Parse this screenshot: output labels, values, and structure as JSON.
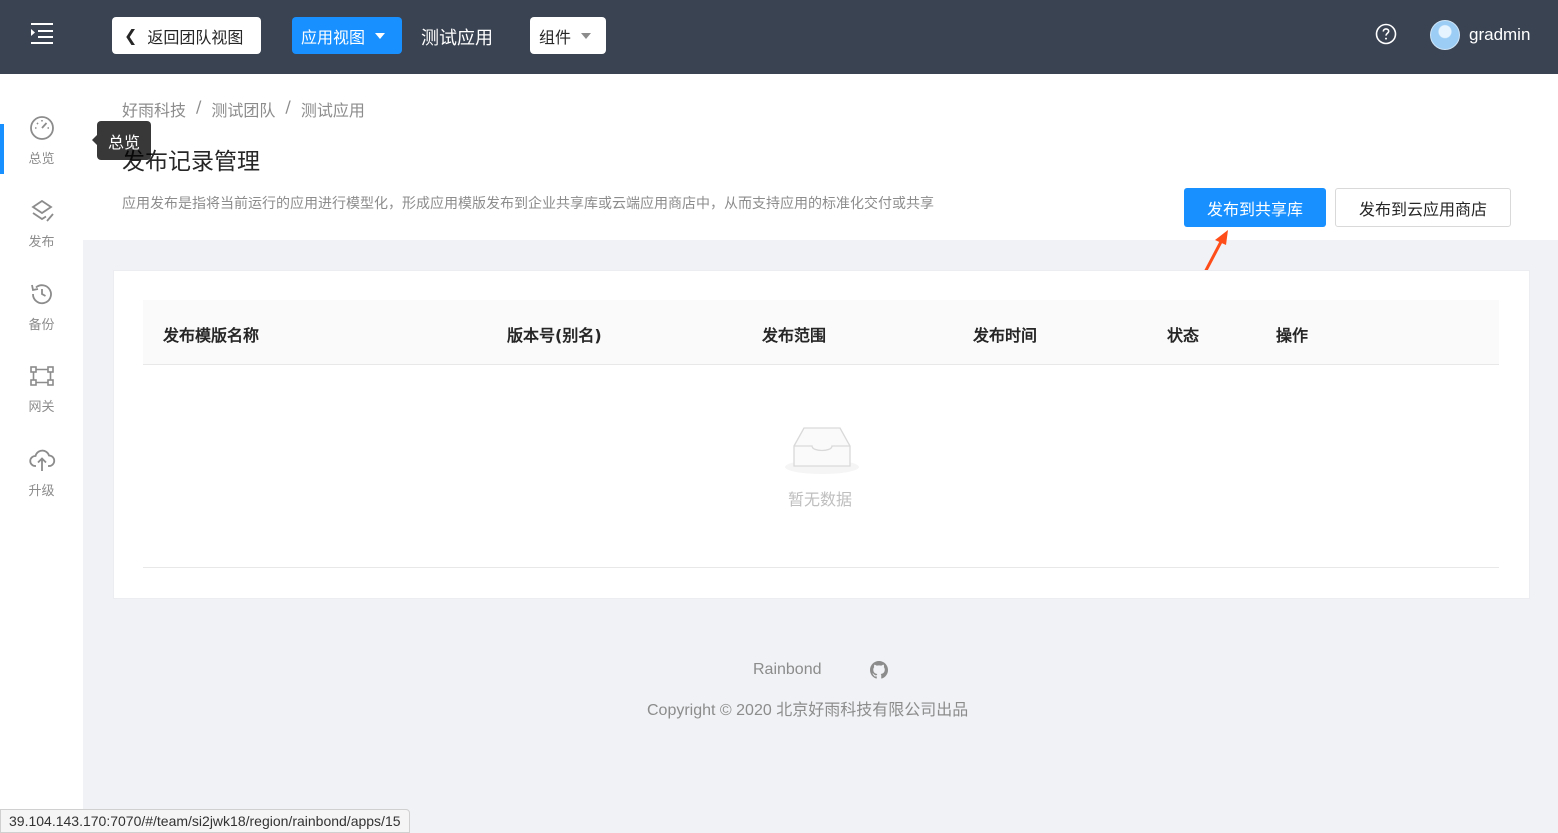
{
  "header": {
    "back_label": "返回团队视图",
    "app_view_label": "应用视图",
    "app_name": "测试应用",
    "component_label": "组件",
    "username": "gradmin"
  },
  "sidebar": {
    "items": [
      {
        "label": "总览",
        "icon": "dashboard-icon"
      },
      {
        "label": "发布",
        "icon": "publish-icon",
        "active": true
      },
      {
        "label": "备份",
        "icon": "backup-icon"
      },
      {
        "label": "网关",
        "icon": "gateway-icon"
      },
      {
        "label": "升级",
        "icon": "upgrade-icon"
      }
    ],
    "tooltip": "总览"
  },
  "breadcrumb": [
    "好雨科技",
    "/",
    "测试团队",
    "/",
    "测试应用"
  ],
  "page": {
    "title": "发布记录管理",
    "description": "应用发布是指将当前运行的应用进行模型化，形成应用模版发布到企业共享库或云端应用商店中，从而支持应用的标准化交付或共享",
    "primary_action": "发布到共享库",
    "secondary_action": "发布到云应用商店"
  },
  "table": {
    "columns": [
      "发布模版名称",
      "版本号(别名)",
      "发布范围",
      "发布时间",
      "状态",
      "操作"
    ],
    "empty_text": "暂无数据"
  },
  "footer": {
    "link": "Rainbond",
    "copyright": "Copyright © 2020 北京好雨科技有限公司出品"
  },
  "status_url": "39.104.143.170:7070/#/team/si2jwk18/region/rainbond/apps/15",
  "colors": {
    "header_bg": "#3a4352",
    "accent": "#1890ff",
    "annotation_arrow": "#ff4d1a"
  }
}
